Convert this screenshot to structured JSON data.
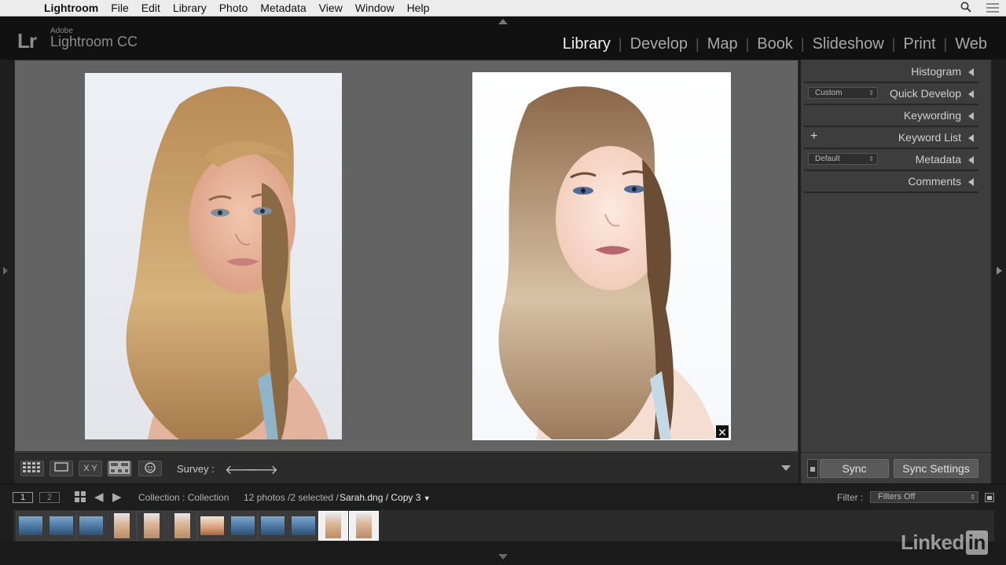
{
  "menubar": {
    "app": "Lightroom",
    "items": [
      "File",
      "Edit",
      "Library",
      "Photo",
      "Metadata",
      "View",
      "Window",
      "Help"
    ]
  },
  "header": {
    "logo": "Lr",
    "vendor": "Adobe",
    "product": "Lightroom CC",
    "modules": [
      {
        "label": "Library",
        "active": true
      },
      {
        "label": "Develop",
        "active": false
      },
      {
        "label": "Map",
        "active": false
      },
      {
        "label": "Book",
        "active": false
      },
      {
        "label": "Slideshow",
        "active": false
      },
      {
        "label": "Print",
        "active": false
      },
      {
        "label": "Web",
        "active": false
      }
    ]
  },
  "right_panel": {
    "histogram": "Histogram",
    "quick_develop": "Quick Develop",
    "quick_develop_preset": "Custom",
    "keywording": "Keywording",
    "keyword_list": "Keyword List",
    "metadata": "Metadata",
    "metadata_preset": "Default",
    "comments": "Comments",
    "sync": "Sync",
    "sync_settings": "Sync Settings"
  },
  "toolbar": {
    "view_label": "Survey :",
    "compare_label": "X Y"
  },
  "filmstrip": {
    "screen1": "1",
    "screen2": "2",
    "source": "Collection : Collection",
    "count": "12 photos /2 selected /",
    "file": "Sarah.dng / Copy 3",
    "filter_label": "Filter :",
    "filter_value": "Filters Off",
    "thumbs": [
      {
        "kind": "landscape",
        "selected": false
      },
      {
        "kind": "landscape",
        "selected": false
      },
      {
        "kind": "landscape",
        "selected": false
      },
      {
        "kind": "portrait",
        "selected": false
      },
      {
        "kind": "portrait",
        "selected": false
      },
      {
        "kind": "portrait",
        "selected": false
      },
      {
        "kind": "landscape-warm",
        "selected": false
      },
      {
        "kind": "landscape",
        "selected": false
      },
      {
        "kind": "landscape",
        "selected": false
      },
      {
        "kind": "landscape",
        "selected": false
      },
      {
        "kind": "portrait",
        "selected": true
      },
      {
        "kind": "portrait",
        "selected": true
      }
    ]
  },
  "watermark": {
    "brand": "LinkedIn"
  },
  "colors": {
    "active_module": "#f2f2f2",
    "inactive_module": "#a8a8a8",
    "panel_bg": "#3d3d3d",
    "canvas_bg": "#636363"
  }
}
